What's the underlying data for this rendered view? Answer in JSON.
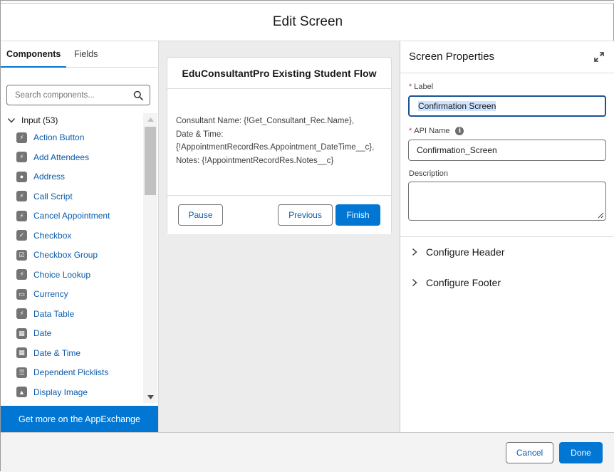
{
  "modal": {
    "title": "Edit Screen"
  },
  "left": {
    "tabs": [
      {
        "label": "Components"
      },
      {
        "label": "Fields"
      }
    ],
    "search": {
      "placeholder": "Search components..."
    },
    "section": {
      "label": "Input (53)"
    },
    "items": [
      {
        "label": "Action Button",
        "icon": "lightning-icon"
      },
      {
        "label": "Add Attendees",
        "icon": "lightning-icon"
      },
      {
        "label": "Address",
        "icon": "location-pin-icon"
      },
      {
        "label": "Call Script",
        "icon": "lightning-icon"
      },
      {
        "label": "Cancel Appointment",
        "icon": "lightning-icon"
      },
      {
        "label": "Checkbox",
        "icon": "checkbox-icon"
      },
      {
        "label": "Checkbox Group",
        "icon": "checkbox-group-icon"
      },
      {
        "label": "Choice Lookup",
        "icon": "lightning-icon"
      },
      {
        "label": "Currency",
        "icon": "currency-icon"
      },
      {
        "label": "Data Table",
        "icon": "lightning-icon"
      },
      {
        "label": "Date",
        "icon": "calendar-icon"
      },
      {
        "label": "Date & Time",
        "icon": "calendar-time-icon"
      },
      {
        "label": "Dependent Picklists",
        "icon": "list-icon"
      },
      {
        "label": "Display Image",
        "icon": "image-icon"
      }
    ],
    "appexchange": {
      "label": "Get more on the AppExchange"
    }
  },
  "canvas": {
    "card_title": "EduConsultantPro Existing Student Flow",
    "body_lines": [
      "Consultant Name: {!Get_Consultant_Rec.Name},",
      "Date & Time:",
      "{!AppointmentRecordRes.Appointment_DateTime__c},",
      "Notes: {!AppointmentRecordRes.Notes__c}"
    ],
    "buttons": {
      "pause": "Pause",
      "previous": "Previous",
      "finish": "Finish"
    }
  },
  "properties": {
    "title": "Screen Properties",
    "label_field": {
      "label": "Label",
      "value": "Confirmation Screen"
    },
    "api_field": {
      "label": "API Name",
      "value": "Confirmation_Screen"
    },
    "description_field": {
      "label": "Description",
      "value": ""
    },
    "sections": [
      {
        "label": "Configure Header"
      },
      {
        "label": "Configure Footer"
      }
    ]
  },
  "footer": {
    "cancel": "Cancel",
    "done": "Done"
  },
  "colors": {
    "brand": "#0176d3",
    "link": "#0b5cab",
    "required": "#c23934"
  }
}
